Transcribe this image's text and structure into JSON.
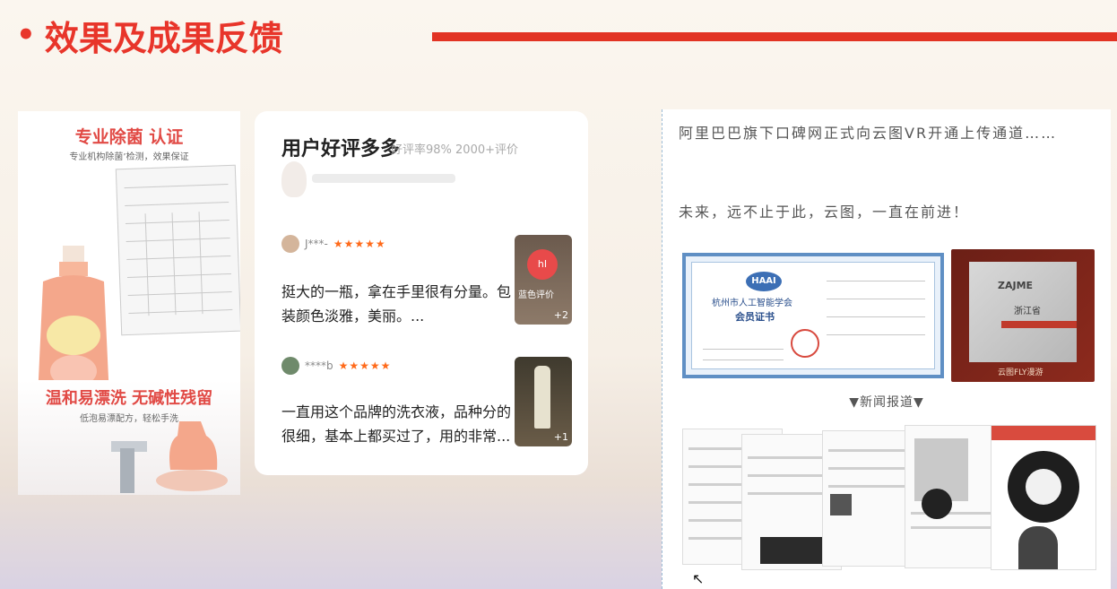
{
  "slide": {
    "title": "效果及成果反馈",
    "bullet": "•"
  },
  "product": {
    "headline1": "专业除菌 认证",
    "sub1": "专业机构除菌’检测，效果保证",
    "headline2": "温和易漂洗 无碱性残留",
    "sub2": "低泡易漂配方，轻松手洗"
  },
  "reviews": {
    "title": "用户好评多多",
    "summary": "好评率98% 2000+评价",
    "items": [
      {
        "user": "J***-",
        "stars": "★★★★★",
        "text": "挺大的一瓶，拿在手里很有分量。包装颜色淡雅，美丽。...",
        "thumb_label": "蓝色评价",
        "thumb_count": "+2"
      },
      {
        "user": "****b",
        "stars": "★★★★★",
        "text": "一直用这个品牌的洗衣液，品种分的很细，基本上都买过了，用的非常...",
        "thumb_count": "+1"
      }
    ]
  },
  "news": {
    "para1": "阿里巴巴旗下口碑网正式向云图VR开通上传通道……",
    "para2": "未来，远不止于此，云图，一直在前进！",
    "cert1_logo": "HAAI",
    "cert1_org": "杭州市人工智能学会",
    "cert1_title": "会员证书",
    "cert2_brand": "ZAJME",
    "cert2_province": "浙江省",
    "cert2_footer": "云图FLY漫游",
    "section_header": "▼新闻报道▼"
  },
  "colors": {
    "accent_red": "#e8352a",
    "star_orange": "#ff6a1a"
  }
}
